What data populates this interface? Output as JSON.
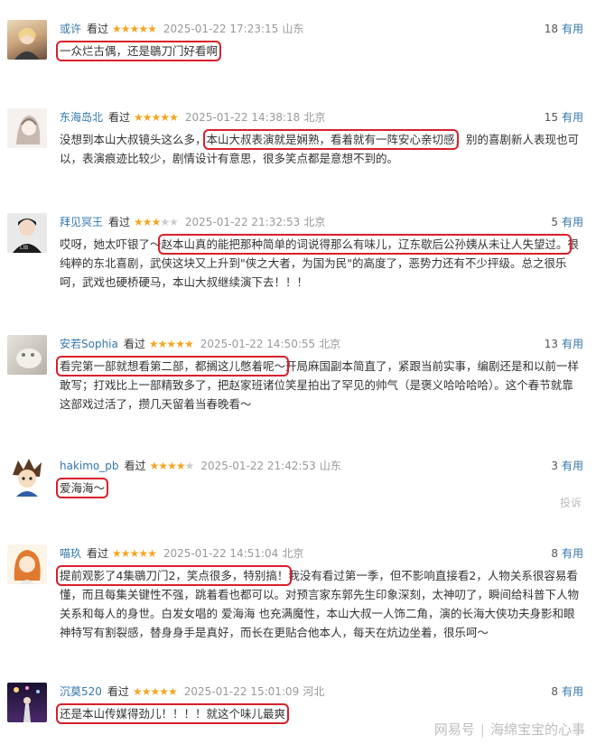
{
  "reviews": [
    {
      "user": "或许",
      "watched": "看过",
      "rating": 5,
      "date": "2025-01-22 17:23:15",
      "loc": "山东",
      "count": "18",
      "useful": "有用",
      "segments": [
        {
          "text": "一众烂古偶，还是鶡刀门好看啊",
          "hl": true
        }
      ]
    },
    {
      "user": "东海岛北",
      "watched": "看过",
      "rating": 5,
      "date": "2025-01-22 14:38:18",
      "loc": "北京",
      "count": "15",
      "useful": "有用",
      "segments": [
        {
          "text": "没想到本山大叔镜头这么多，",
          "hl": false
        },
        {
          "text": "本山大叔表演就是娴熟，看着就有一阵安心亲切感",
          "hl": true
        },
        {
          "text": "，别的喜剧新人表现也可以，表演痕迹比较少，剧情设计有意思，很多笑点都是意想不到的。",
          "hl": false
        }
      ]
    },
    {
      "user": "拜见冥王",
      "watched": "看过",
      "rating": 3,
      "date": "2025-01-22 21:32:53",
      "loc": "北京",
      "count": "5",
      "useful": "有用",
      "segments": [
        {
          "text": "哎呀，她太吓银了～",
          "hl": false
        },
        {
          "text": "赵本山真的能把那种简单的词说得那么有味儿，辽东歇后公孙姨从未让人失望过。",
          "hl": true
        },
        {
          "text": "很纯粹的东北喜剧，武侠这块又上升到\"侠之大者，为国为民\"的高度了，恶势力还有不少抨级。总之很乐呵，武戏也硬桥硬马，本山大叔继续演下去！！！",
          "hl": false
        }
      ]
    },
    {
      "user": "安若Sophia",
      "watched": "看过",
      "rating": 5,
      "date": "2025-01-22 14:50:55",
      "loc": "北京",
      "count": "13",
      "useful": "有用",
      "segments": [
        {
          "text": "看完第一部就想看第二部，都搁这儿憋着呢～",
          "hl": true
        },
        {
          "text": "开局麻国副本简直了，紧跟当前实事，编剧还是和以前一样敢写；打戏比上一部精致多了，把赵家班诸位笑星拍出了罕见的帅气（是褒义哈哈哈哈）。这个春节就靠这部戏过活了，攒几天留着当春晚看～",
          "hl": false
        }
      ]
    },
    {
      "user": "hakimo_pb",
      "watched": "看过",
      "rating": 4,
      "date": "2025-01-22 21:42:53",
      "loc": "山东",
      "count": "3",
      "useful": "有用",
      "segments": [
        {
          "text": "爱海海～",
          "hl": true
        }
      ],
      "report": "投诉"
    },
    {
      "user": "喵玖",
      "watched": "看过",
      "rating": 5,
      "date": "2025-01-22 14:51:04",
      "loc": "北京",
      "count": "8",
      "useful": "有用",
      "segments": [
        {
          "text": "提前观影了4集鶡刀门2，笑点很多，特别搞！",
          "hl": true
        },
        {
          "text": "我没有看过第一季，但不影响直接看2，人物关系很容易看懂，而且每集关键性不强，跳着看也都可以。对预言家东郭先生印象深刻，太神叨了，瞬间给科普下人物关系和每人的身世。白发女唱的 爱海海 也充满魔性，本山大叔一人饰二角，演的长海大侠功夫身影和眼神特写有割裂感，替身身手是真好，而长在更贴合他本人，每天在炕边坐着，很乐呵～",
          "hl": false
        }
      ]
    },
    {
      "user": "沉莫520",
      "watched": "看过",
      "rating": 5,
      "date": "2025-01-22 15:01:09",
      "loc": "河北",
      "count": "8",
      "useful": "有用",
      "segments": [
        {
          "text": "还是本山传媒得劲儿！！！！就这个味儿最爽",
          "hl": true
        }
      ]
    }
  ],
  "footer": {
    "brand": "网易号",
    "author": "海绵宝宝的心事"
  },
  "colors": {
    "user": "#3377aa",
    "star": "#f5a623",
    "highlight": "#d9202a"
  },
  "avatars": [
    "avatar-girl-blond",
    "avatar-girl-sketch",
    "avatar-boy-dark",
    "avatar-cat",
    "avatar-anime-boy",
    "avatar-anime-girl",
    "avatar-concert"
  ]
}
